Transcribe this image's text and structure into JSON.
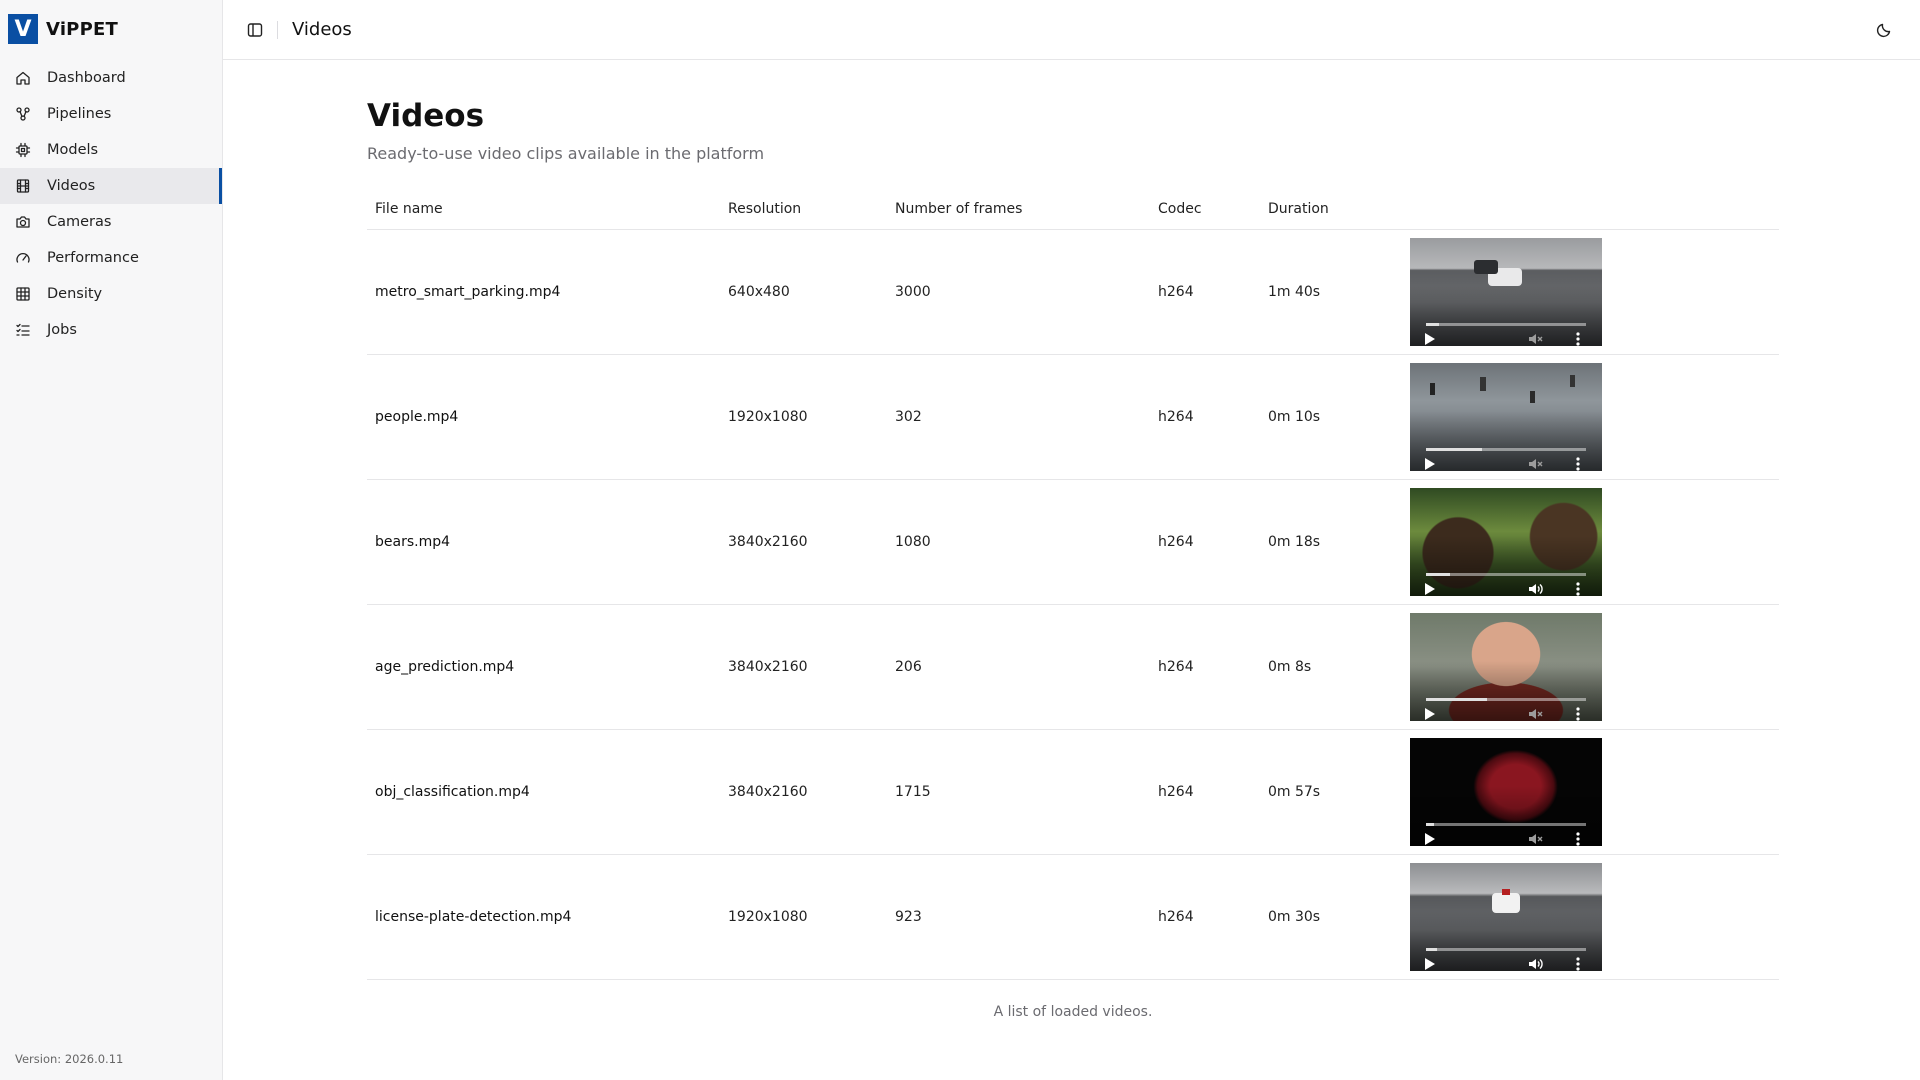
{
  "app": {
    "logo_letter": "V",
    "name": "ViPPET",
    "version": "Version: 2026.0.11"
  },
  "sidebar": {
    "items": [
      {
        "label": "Dashboard",
        "icon": "home-icon",
        "active": false
      },
      {
        "label": "Pipelines",
        "icon": "pipeline-icon",
        "active": false
      },
      {
        "label": "Models",
        "icon": "chip-icon",
        "active": false
      },
      {
        "label": "Videos",
        "icon": "film-icon",
        "active": true
      },
      {
        "label": "Cameras",
        "icon": "camera-icon",
        "active": false
      },
      {
        "label": "Performance",
        "icon": "gauge-icon",
        "active": false
      },
      {
        "label": "Density",
        "icon": "grid-icon",
        "active": false
      },
      {
        "label": "Jobs",
        "icon": "list-checks-icon",
        "active": false
      }
    ]
  },
  "header": {
    "title": "Videos"
  },
  "page": {
    "title": "Videos",
    "subtitle": "Ready-to-use video clips available in the platform",
    "caption": "A list of loaded videos."
  },
  "table": {
    "columns": [
      "File name",
      "Resolution",
      "Number of frames",
      "Codec",
      "Duration",
      ""
    ],
    "rows": [
      {
        "file_name": "metro_smart_parking.mp4",
        "resolution": "640x480",
        "frames": "3000",
        "codec": "h264",
        "duration": "1m 40s",
        "progress": 0.08,
        "muted": true,
        "scene": "parking"
      },
      {
        "file_name": "people.mp4",
        "resolution": "1920x1080",
        "frames": "302",
        "codec": "h264",
        "duration": "0m 10s",
        "progress": 0.35,
        "muted": true,
        "scene": "street"
      },
      {
        "file_name": "bears.mp4",
        "resolution": "3840x2160",
        "frames": "1080",
        "codec": "h264",
        "duration": "0m 18s",
        "progress": 0.15,
        "muted": false,
        "scene": "bears"
      },
      {
        "file_name": "age_prediction.mp4",
        "resolution": "3840x2160",
        "frames": "206",
        "codec": "h264",
        "duration": "0m 8s",
        "progress": 0.38,
        "muted": true,
        "scene": "face"
      },
      {
        "file_name": "obj_classification.mp4",
        "resolution": "3840x2160",
        "frames": "1715",
        "codec": "h264",
        "duration": "0m 57s",
        "progress": 0.05,
        "muted": true,
        "scene": "apple"
      },
      {
        "file_name": "license-plate-detection.mp4",
        "resolution": "1920x1080",
        "frames": "923",
        "codec": "h264",
        "duration": "0m 30s",
        "progress": 0.07,
        "muted": false,
        "scene": "parking2"
      }
    ]
  },
  "colors": {
    "brand": "#0a4fa3",
    "sidebar_bg": "#f7f7f8",
    "active_bg": "#e9e9ec"
  }
}
